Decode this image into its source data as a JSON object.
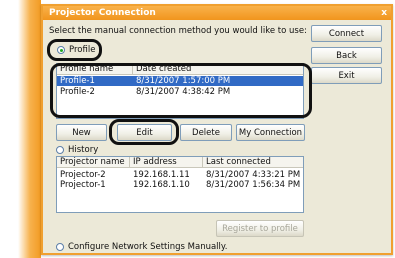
{
  "window": {
    "title": "Projector Connection",
    "close_glyph": "x"
  },
  "instruction": "Select the manual connection method you would like to use:",
  "side_buttons": {
    "connect": "Connect",
    "back": "Back",
    "exit": "Exit"
  },
  "profile": {
    "radio_label": "Profile",
    "columns": [
      "Profile name",
      "Date created"
    ],
    "rows": [
      {
        "name": "Profile-1",
        "date": "8/31/2007 1:57:00 PM",
        "selected": true
      },
      {
        "name": "Profile-2",
        "date": "8/31/2007 4:38:42 PM",
        "selected": false
      }
    ],
    "buttons": {
      "new": "New",
      "edit": "Edit",
      "delete": "Delete",
      "my_connection": "My Connection"
    }
  },
  "history": {
    "radio_label": "History",
    "columns": [
      "Projector name",
      "IP address",
      "Last connected"
    ],
    "rows": [
      {
        "name": "Projector-2",
        "ip": "192.168.1.11",
        "last": "8/31/2007 4:33:21 PM"
      },
      {
        "name": "Projector-1",
        "ip": "192.168.1.10",
        "last": "8/31/2007 1:56:34 PM"
      }
    ],
    "register_button": "Register to profile"
  },
  "network_option": "Configure Network Settings Manually.",
  "colors": {
    "accent": "#f29a22",
    "selection": "#316ac5",
    "dialog_bg": "#ece9d8"
  }
}
